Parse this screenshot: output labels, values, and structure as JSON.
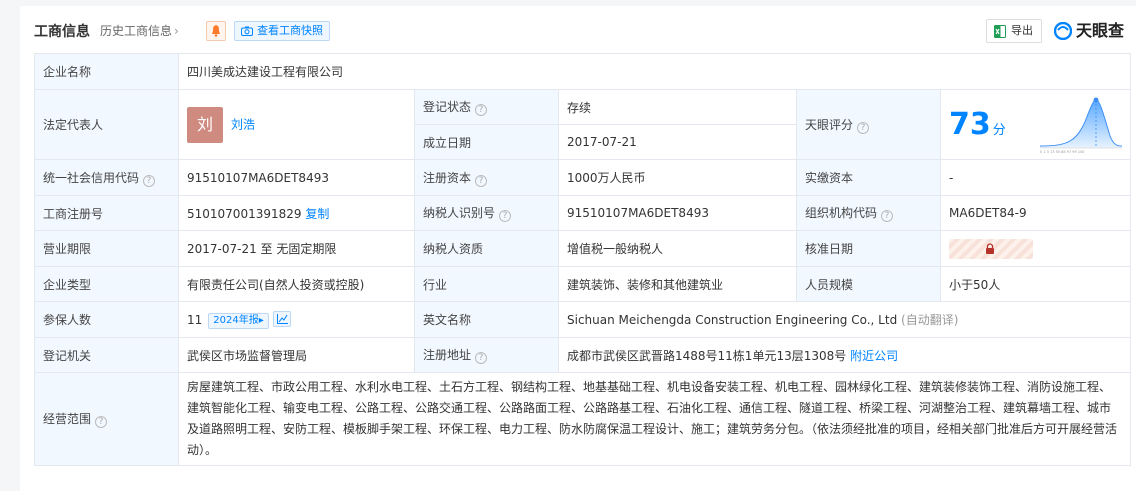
{
  "header": {
    "title": "工商信息",
    "history": "历史工商信息",
    "snapshot": "查看工商快照",
    "export": "导出",
    "logo": "天眼查"
  },
  "rows": {
    "company_name": {
      "label": "企业名称",
      "value": "四川美成达建设工程有限公司"
    },
    "legal_rep": {
      "label": "法定代表人",
      "avatar": "刘",
      "name": "刘浩"
    },
    "reg_status": {
      "label": "登记状态",
      "value": "存续"
    },
    "est_date": {
      "label": "成立日期",
      "value": "2017-07-21"
    },
    "score": {
      "label": "天眼评分",
      "value": "73",
      "unit": "分"
    },
    "credit_code": {
      "label": "统一社会信用代码",
      "value": "91510107MA6DET8493"
    },
    "reg_capital": {
      "label": "注册资本",
      "value": "1000万人民币"
    },
    "paid_capital": {
      "label": "实缴资本",
      "value": "-"
    },
    "reg_no": {
      "label": "工商注册号",
      "value": "510107001391829",
      "copy": "复制"
    },
    "taxpayer_id": {
      "label": "纳税人识别号",
      "value": "91510107MA6DET8493"
    },
    "org_code": {
      "label": "组织机构代码",
      "value": "MA6DET84-9"
    },
    "term": {
      "label": "营业期限",
      "value": "2017-07-21 至 无固定期限"
    },
    "taxpayer_qual": {
      "label": "纳税人资质",
      "value": "增值税一般纳税人"
    },
    "approval_date": {
      "label": "核准日期"
    },
    "company_type": {
      "label": "企业类型",
      "value": "有限责任公司(自然人投资或控股)"
    },
    "industry": {
      "label": "行业",
      "value": "建筑装饰、装修和其他建筑业"
    },
    "staff_size": {
      "label": "人员规模",
      "value": "小于50人"
    },
    "insured": {
      "label": "参保人数",
      "value": "11",
      "badge": "2024年报"
    },
    "english_name": {
      "label": "英文名称",
      "value": "Sichuan Meichengda Construction Engineering Co., Ltd",
      "note": "(自动翻译)"
    },
    "authority": {
      "label": "登记机关",
      "value": "武侯区市场监督管理局"
    },
    "address": {
      "label": "注册地址",
      "value": "成都市武侯区武晋路1488号11栋1单元13层1308号",
      "nearby": "附近公司"
    },
    "scope": {
      "label": "经营范围",
      "value": "房屋建筑工程、市政公用工程、水利水电工程、土石方工程、钢结构工程、地基基础工程、机电设备安装工程、机电工程、园林绿化工程、建筑装修装饰工程、消防设施工程、建筑智能化工程、输变电工程、公路工程、公路交通工程、公路路面工程、公路路基工程、石油化工程、通信工程、隧道工程、桥梁工程、河湖整治工程、建筑幕墙工程、城市及道路照明工程、安防工程、模板脚手架工程、环保工程、电力工程、防水防腐保温工程设计、施工；建筑劳务分包。（依法须经批准的项目，经相关部门批准后方可开展经营活动）。"
    }
  },
  "colors": {
    "accent": "#0084ff",
    "label_bg": "#f2f8ff",
    "status_green": "#25a85a",
    "avatar": "#d08b80"
  },
  "icons": [
    "bell-icon",
    "camera-icon",
    "excel-icon",
    "tianyancha-logo-icon",
    "question-icon",
    "trend-chart-icon",
    "lock-icon",
    "score-curve-icon"
  ]
}
